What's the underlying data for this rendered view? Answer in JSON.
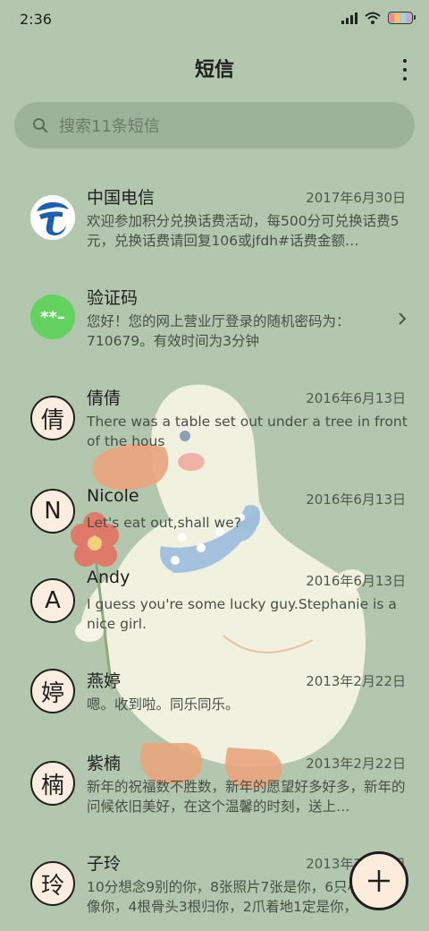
{
  "status_bar": {
    "time": "2:36"
  },
  "header": {
    "title": "短信"
  },
  "search": {
    "placeholder": "搜索11条短信"
  },
  "conversations": [
    {
      "name": "中国电信",
      "date": "2017年6月30日",
      "preview": "欢迎参加积分兑换话费活动，每500分可兑换话费5元，兑换话费请回复106或jfdh#话费金额…",
      "avatar_type": "logo",
      "avatar_icon": "china-telecom-logo"
    },
    {
      "name": "验证码",
      "date": "",
      "preview": "您好！您的网上营业厅登录的随机密码为：710679。有效时间为3分钟",
      "avatar_type": "code",
      "avatar_text": "**–"
    },
    {
      "name": "倩倩",
      "date": "2016年6月13日",
      "preview": "There was a table set out under a tree in front of the hous",
      "avatar_type": "letter",
      "avatar_text": "倩"
    },
    {
      "name": "Nicole",
      "date": "2016年6月13日",
      "preview": "Let's eat out,shall we?",
      "avatar_type": "letter",
      "avatar_text": "N"
    },
    {
      "name": "Andy",
      "date": "2016年6月13日",
      "preview": "I guess you're some lucky guy.Stephanie is a nice girl.",
      "avatar_type": "letter",
      "avatar_text": "A"
    },
    {
      "name": "燕婷",
      "date": "2013年2月22日",
      "preview": "嗯。收到啦。同乐同乐。",
      "avatar_type": "letter",
      "avatar_text": "婷"
    },
    {
      "name": "紫楠",
      "date": "2013年2月22日",
      "preview": "新年的祝福数不胜数，新年的愿望好多好多，新年的问候依旧美好，在这个温馨的时刻，送上…",
      "avatar_type": "letter",
      "avatar_text": "楠"
    },
    {
      "name": "子玲",
      "date": "2013年2月22日",
      "preview": "10分想念9别的你，8张照片7张是你，6只小猪5只像你，4根骨头3根归你，2爪着地1定是你，",
      "avatar_type": "letter",
      "avatar_text": "玲"
    }
  ],
  "fab": {
    "label": "+"
  },
  "colors": {
    "background": "#b3c7ae",
    "search_bg": "#96ac92",
    "avatar_fill": "#fbeee0",
    "code_green": "#63d25f",
    "telecom_blue": "#1b5fb3"
  }
}
